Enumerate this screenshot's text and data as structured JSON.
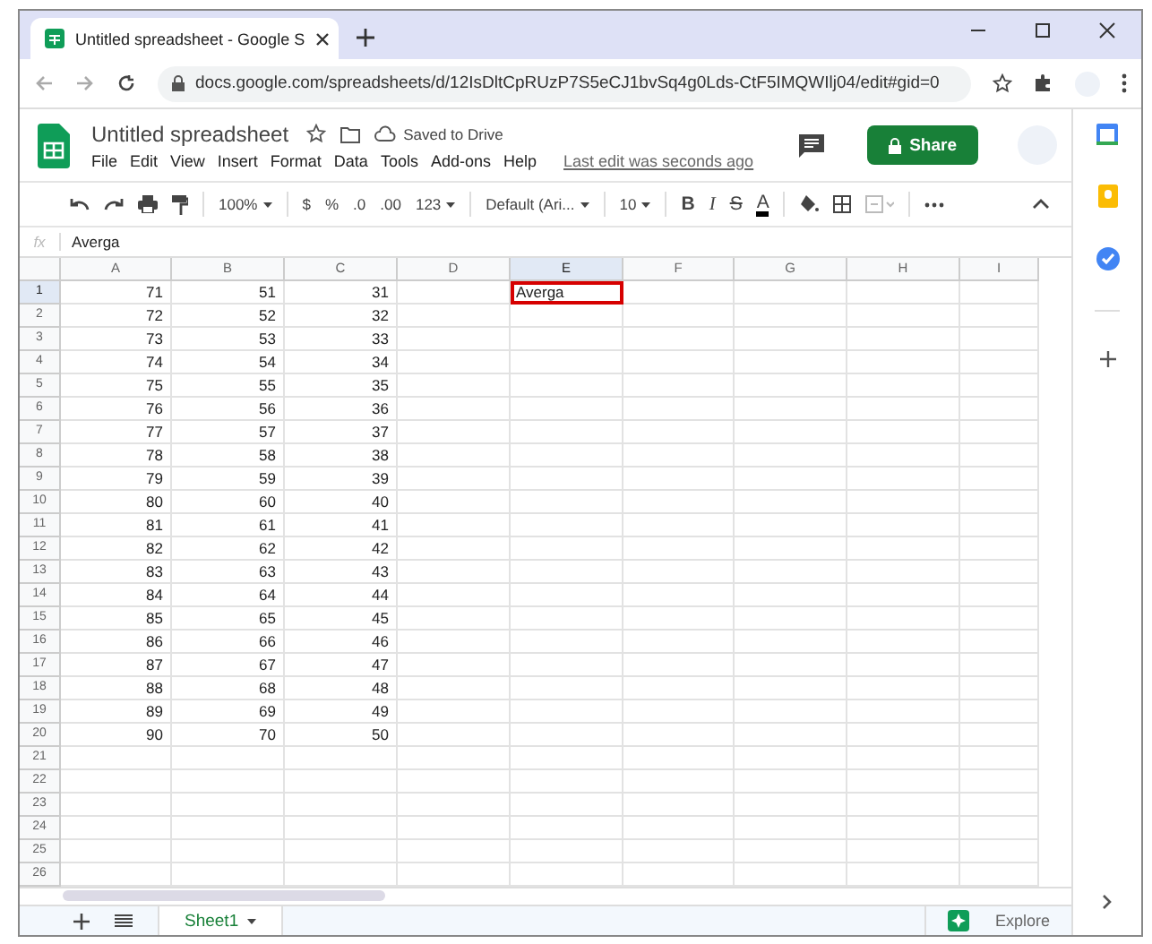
{
  "browser": {
    "tab_title": "Untitled spreadsheet - Google S",
    "url": "docs.google.com/spreadsheets/d/12IsDltCpRUzP7S5eCJ1bvSq4g0Lds-CtF5IMQWIlj04/edit#gid=0"
  },
  "header": {
    "title": "Untitled spreadsheet",
    "saved_status": "Saved to Drive",
    "menus": [
      "File",
      "Edit",
      "View",
      "Insert",
      "Format",
      "Data",
      "Tools",
      "Add-ons",
      "Help"
    ],
    "last_edit": "Last edit was seconds ago",
    "share": "Share"
  },
  "toolbar": {
    "zoom": "100%",
    "currency": "$",
    "percent": "%",
    "decrease_decimals": ".0",
    "increase_decimals": ".00",
    "number_format": "123",
    "font": "Default (Ari...",
    "font_size": "10",
    "bold": "B",
    "italic": "I",
    "strikethrough": "S",
    "text_color": "A"
  },
  "formula_bar": {
    "label": "fx",
    "value": "Averga"
  },
  "grid": {
    "columns": [
      {
        "label": "A",
        "selected": false
      },
      {
        "label": "B",
        "selected": false
      },
      {
        "label": "C",
        "selected": false
      },
      {
        "label": "D",
        "selected": false
      },
      {
        "label": "E",
        "selected": true
      },
      {
        "label": "F",
        "selected": false
      },
      {
        "label": "G",
        "selected": false
      },
      {
        "label": "H",
        "selected": false
      },
      {
        "label": "I",
        "selected": false
      }
    ],
    "active_cell_value": "Averga",
    "rows": [
      {
        "number": "1",
        "selected": true,
        "cells": [
          "71",
          "51",
          "31"
        ]
      },
      {
        "number": "2",
        "selected": false,
        "cells": [
          "72",
          "52",
          "32"
        ]
      },
      {
        "number": "3",
        "selected": false,
        "cells": [
          "73",
          "53",
          "33"
        ]
      },
      {
        "number": "4",
        "selected": false,
        "cells": [
          "74",
          "54",
          "34"
        ]
      },
      {
        "number": "5",
        "selected": false,
        "cells": [
          "75",
          "55",
          "35"
        ]
      },
      {
        "number": "6",
        "selected": false,
        "cells": [
          "76",
          "56",
          "36"
        ]
      },
      {
        "number": "7",
        "selected": false,
        "cells": [
          "77",
          "57",
          "37"
        ]
      },
      {
        "number": "8",
        "selected": false,
        "cells": [
          "78",
          "58",
          "38"
        ]
      },
      {
        "number": "9",
        "selected": false,
        "cells": [
          "79",
          "59",
          "39"
        ]
      },
      {
        "number": "10",
        "selected": false,
        "cells": [
          "80",
          "60",
          "40"
        ]
      },
      {
        "number": "11",
        "selected": false,
        "cells": [
          "81",
          "61",
          "41"
        ]
      },
      {
        "number": "12",
        "selected": false,
        "cells": [
          "82",
          "62",
          "42"
        ]
      },
      {
        "number": "13",
        "selected": false,
        "cells": [
          "83",
          "63",
          "43"
        ]
      },
      {
        "number": "14",
        "selected": false,
        "cells": [
          "84",
          "64",
          "44"
        ]
      },
      {
        "number": "15",
        "selected": false,
        "cells": [
          "85",
          "65",
          "45"
        ]
      },
      {
        "number": "16",
        "selected": false,
        "cells": [
          "86",
          "66",
          "46"
        ]
      },
      {
        "number": "17",
        "selected": false,
        "cells": [
          "87",
          "67",
          "47"
        ]
      },
      {
        "number": "18",
        "selected": false,
        "cells": [
          "88",
          "68",
          "48"
        ]
      },
      {
        "number": "19",
        "selected": false,
        "cells": [
          "89",
          "69",
          "49"
        ]
      },
      {
        "number": "20",
        "selected": false,
        "cells": [
          "90",
          "70",
          "50"
        ]
      },
      {
        "number": "21",
        "selected": false,
        "cells": []
      },
      {
        "number": "22",
        "selected": false,
        "cells": []
      },
      {
        "number": "23",
        "selected": false,
        "cells": []
      },
      {
        "number": "24",
        "selected": false,
        "cells": []
      },
      {
        "number": "25",
        "selected": false,
        "cells": []
      },
      {
        "number": "26",
        "selected": false,
        "cells": []
      }
    ]
  },
  "sheets": [
    {
      "name": "Sheet1",
      "selected": true
    }
  ],
  "explore": "Explore"
}
